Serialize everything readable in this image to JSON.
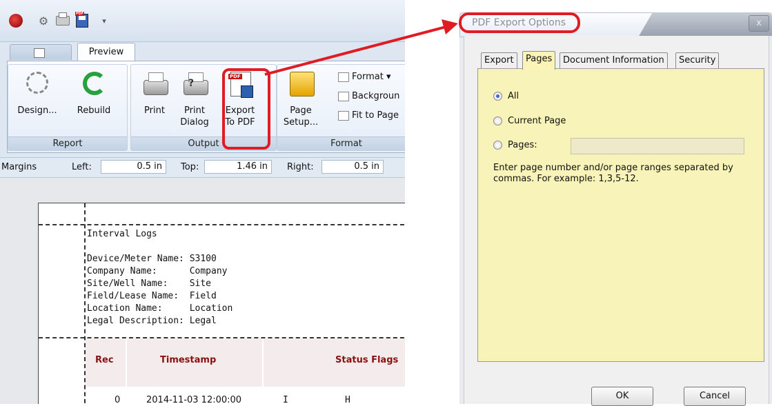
{
  "app": {
    "tabs": [
      "",
      "Preview"
    ],
    "ribbon": {
      "report": {
        "label": "Report",
        "design": "Design...",
        "rebuild": "Rebuild"
      },
      "output": {
        "label": "Output",
        "print": "Print",
        "print_dialog_1": "Print",
        "print_dialog_2": "Dialog",
        "export_1": "Export",
        "export_2": "To PDF"
      },
      "format": {
        "label": "Format",
        "page_setup_1": "Page",
        "page_setup_2": "Setup...",
        "format_menu": "Format",
        "background": "Backgroun",
        "fit_to_page": "Fit to Page"
      }
    },
    "margins": {
      "label": "Margins",
      "left_label": "Left:",
      "left_value": "0.5 in",
      "top_label": "Top:",
      "top_value": "1.46 in",
      "right_label": "Right:",
      "right_value": "0.5 in"
    },
    "report": {
      "title": "Interval Logs",
      "fields": [
        "Device/Meter Name: S3100",
        "Company Name:      Company",
        "Site/Well Name:    Site",
        "Field/Lease Name:  Field",
        "Location Name:     Location",
        "Legal Description: Legal"
      ],
      "columns": [
        "Rec",
        "Timestamp",
        "Status Flags"
      ],
      "row": [
        "0",
        "2014-11-03 12:00:00",
        "I",
        "H"
      ]
    }
  },
  "dialog": {
    "title": "PDF Export Options",
    "close": "x",
    "tabs": [
      "Export",
      "Pages",
      "Document Information",
      "Security"
    ],
    "active_tab": "Pages",
    "options": {
      "all": "All",
      "current": "Current Page",
      "pages": "Pages:"
    },
    "selected_option": "All",
    "pages_value": "",
    "hint": "Enter page number and/or page ranges separated by commas. For example: 1,3,5-12.",
    "ok": "OK",
    "cancel": "Cancel"
  },
  "colors": {
    "highlight": "#e01b24",
    "panel": "#f8f3b8",
    "header_text": "#8b1010"
  }
}
